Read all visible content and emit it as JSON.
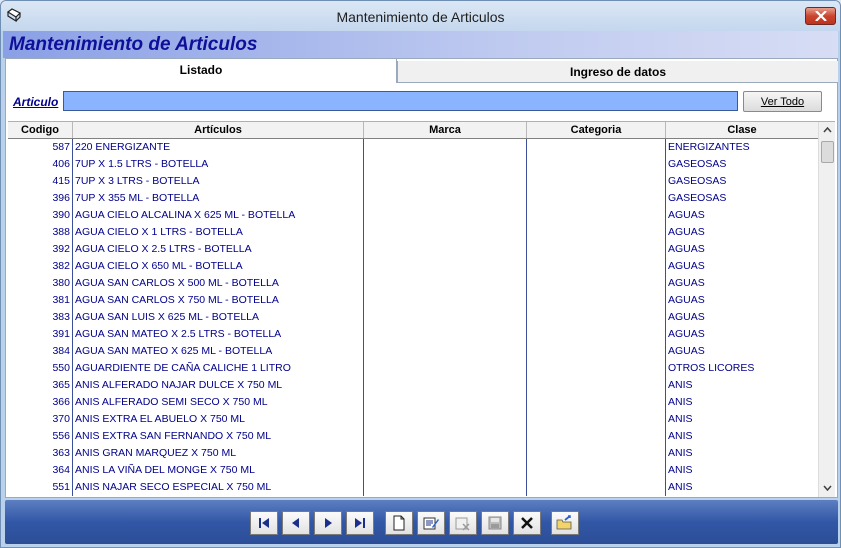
{
  "window": {
    "title": "Mantenimiento de Articulos"
  },
  "heading": "Mantenimiento de Articulos",
  "tabs": [
    {
      "label": "Listado"
    },
    {
      "label": "Ingreso de datos"
    }
  ],
  "search": {
    "label": "Articulo",
    "value": "",
    "button_label": "Ver Todo"
  },
  "table": {
    "columns": [
      "Codigo",
      "Artículos",
      "Marca",
      "Categoria",
      "Clase"
    ],
    "rows": [
      [
        "587",
        "220 ENERGIZANTE",
        "",
        "",
        "ENERGIZANTES"
      ],
      [
        "406",
        "7UP X 1.5 LTRS - BOTELLA",
        "",
        "",
        "GASEOSAS"
      ],
      [
        "415",
        "7UP X 3 LTRS - BOTELLA",
        "",
        "",
        "GASEOSAS"
      ],
      [
        "396",
        "7UP X 355 ML - BOTELLA",
        "",
        "",
        "GASEOSAS"
      ],
      [
        "390",
        "AGUA CIELO ALCALINA X 625 ML - BOTELLA",
        "",
        "",
        "AGUAS"
      ],
      [
        "388",
        "AGUA CIELO X 1 LTRS - BOTELLA",
        "",
        "",
        "AGUAS"
      ],
      [
        "392",
        "AGUA CIELO X 2.5 LTRS - BOTELLA",
        "",
        "",
        "AGUAS"
      ],
      [
        "382",
        "AGUA CIELO X 650 ML - BOTELLA",
        "",
        "",
        "AGUAS"
      ],
      [
        "380",
        "AGUA SAN CARLOS X 500 ML - BOTELLA",
        "",
        "",
        "AGUAS"
      ],
      [
        "381",
        "AGUA SAN CARLOS X 750 ML - BOTELLA",
        "",
        "",
        "AGUAS"
      ],
      [
        "383",
        "AGUA SAN LUIS X 625 ML - BOTELLA",
        "",
        "",
        "AGUAS"
      ],
      [
        "391",
        "AGUA SAN MATEO X 2.5 LTRS - BOTELLA",
        "",
        "",
        "AGUAS"
      ],
      [
        "384",
        "AGUA SAN MATEO X 625 ML - BOTELLA",
        "",
        "",
        "AGUAS"
      ],
      [
        "550",
        "AGUARDIENTE DE CAÑA CALICHE 1 LITRO",
        "",
        "",
        "OTROS LICORES"
      ],
      [
        "365",
        "ANIS ALFERADO NAJAR DULCE X 750 ML",
        "",
        "",
        "ANIS"
      ],
      [
        "366",
        "ANIS ALFERADO SEMI SECO X 750 ML",
        "",
        "",
        "ANIS"
      ],
      [
        "370",
        "ANIS EXTRA EL ABUELO X 750 ML",
        "",
        "",
        "ANIS"
      ],
      [
        "556",
        "ANIS EXTRA SAN FERNANDO X 750 ML",
        "",
        "",
        "ANIS"
      ],
      [
        "363",
        "ANIS GRAN MARQUEZ X 750 ML",
        "",
        "",
        "ANIS"
      ],
      [
        "364",
        "ANIS LA VIÑA DEL MONGE X 750 ML",
        "",
        "",
        "ANIS"
      ],
      [
        "551",
        "ANIS NAJAR SECO ESPECIAL X 750 ML",
        "",
        "",
        "ANIS"
      ]
    ]
  },
  "toolbar": {
    "buttons": [
      {
        "icon": "first-record-icon"
      },
      {
        "icon": "previous-record-icon"
      },
      {
        "icon": "next-record-icon"
      },
      {
        "icon": "last-record-icon"
      },
      {
        "icon": "new-document-icon"
      },
      {
        "icon": "edit-icon"
      },
      {
        "icon": "undo-disabled-icon"
      },
      {
        "icon": "save-disabled-icon"
      },
      {
        "icon": "delete-icon"
      },
      {
        "icon": "exit-folder-icon"
      }
    ]
  },
  "colors": {
    "heading": "#0f0f99",
    "grid_text": "#00008b",
    "search_field": "#8ab4ff",
    "bottom_bar": "#3257a6",
    "close_button": "#c9452f"
  }
}
